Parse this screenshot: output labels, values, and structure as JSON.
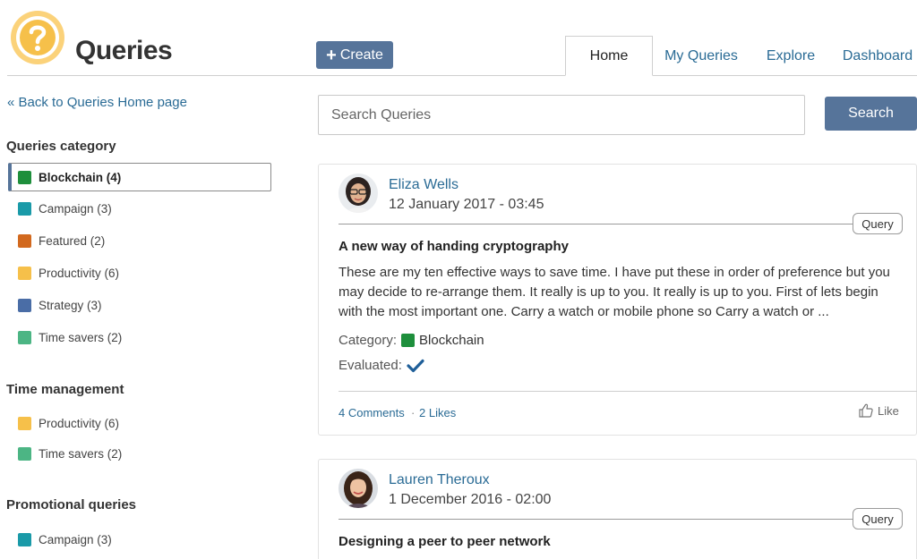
{
  "app": {
    "title": "Queries",
    "logo_icon": "question-mark-icon"
  },
  "toolbar": {
    "create_label": "Create"
  },
  "nav": {
    "tabs": [
      {
        "label": "Home",
        "active": true
      },
      {
        "label": "My Queries",
        "active": false
      },
      {
        "label": "Explore",
        "active": false
      },
      {
        "label": "Dashboard",
        "active": false
      }
    ]
  },
  "search": {
    "placeholder": "Search Queries",
    "value": "",
    "button_label": "Search"
  },
  "sidebar": {
    "back_link": "« Back to Queries Home page",
    "sections": [
      {
        "title": "Queries category",
        "items": [
          {
            "label": "Blockchain (4)",
            "color": "#1e8f3c",
            "active": true
          },
          {
            "label": "Campaign (3)",
            "color": "#1a9aa8",
            "active": false
          },
          {
            "label": "Featured (2)",
            "color": "#d2691e",
            "active": false
          },
          {
            "label": "Productivity (6)",
            "color": "#f6c04a",
            "active": false
          },
          {
            "label": "Strategy (3)",
            "color": "#4a6da6",
            "active": false
          },
          {
            "label": "Time savers (2)",
            "color": "#4cb584",
            "active": false
          }
        ]
      },
      {
        "title": "Time management",
        "items": [
          {
            "label": "Productivity (6)",
            "color": "#f6c04a"
          },
          {
            "label": "Time savers (2)",
            "color": "#4cb584"
          }
        ]
      },
      {
        "title": "Promotional queries",
        "items": [
          {
            "label": "Campaign (3)",
            "color": "#1a9aa8"
          }
        ]
      }
    ]
  },
  "posts": [
    {
      "author": "Eliza Wells",
      "date": "12 January 2017 - 03:45",
      "badge": "Query",
      "title": "A new way of handing cryptography",
      "excerpt": "These are my ten effective ways to save time. I have put these in order of preference but you may decide to re-arrange them. It really is up to you. It really is up to you. First of lets begin with the most important one. Carry a watch or mobile phone so Carry a watch or ...",
      "category_label": "Category:",
      "category_value": "Blockchain",
      "category_color": "#1e8f3c",
      "evaluated_label": "Evaluated:",
      "comments": "4 Comments",
      "separator": "·",
      "likes": "2 Likes",
      "like_label": "Like"
    },
    {
      "author": "Lauren Theroux",
      "date": "1 December 2016 - 02:00",
      "badge": "Query",
      "title": "Designing a peer to peer network"
    }
  ],
  "colors": {
    "accent": "#56749a",
    "link": "#2a6b95",
    "logo": "#f6c04a",
    "check": "#1f5f99"
  }
}
